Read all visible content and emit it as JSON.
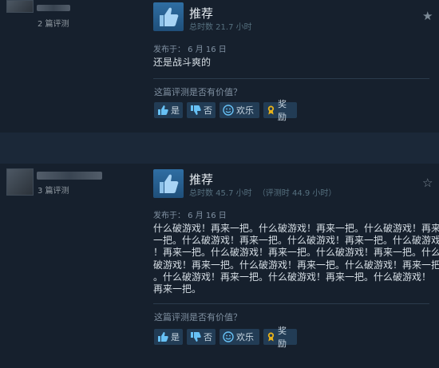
{
  "reviews": [
    {
      "author_reviews": "2 篇评测",
      "recommendation": "推荐",
      "hours": "总时数 21.7 小时",
      "hours_at_review": "",
      "posted": "发布于： 6 月 16 日",
      "content": [
        "还是战斗爽的"
      ],
      "helpful_question": "这篇评测是否有价值？",
      "buttons": {
        "yes": "是",
        "no": "否",
        "funny": "欢乐",
        "award": "奖励"
      }
    },
    {
      "author_reviews": "3 篇评测",
      "recommendation": "推荐",
      "hours": "总时数 45.7 小时",
      "hours_at_review": "（评测时 44.9 小时）",
      "posted": "发布于： 6 月 16 日",
      "content": [
        "什么破游戏！再来一把。什么破游戏！再来一把。什么破游戏！再来",
        "一把。什么破游戏！再来一把。什么破游戏！再来一把。什么破游戏",
        "！再来一把。什么破游戏！再来一把。什么破游戏！再来一把。什么",
        "破游戏！再来一把。什么破游戏！再来一把。什么破游戏！再来一把",
        "。什么破游戏！再来一把。什么破游戏！再来一把。什么破游戏！",
        "再来一把。"
      ],
      "helpful_question": "这篇评测是否有价值？",
      "buttons": {
        "yes": "是",
        "no": "否",
        "funny": "欢乐",
        "award": "奖励"
      }
    }
  ],
  "colors": {
    "background": "#1b2838",
    "review_panel": "#16202d",
    "thumb": "#2f6ea3",
    "button": "#223c55",
    "award": "#e8b21a"
  }
}
